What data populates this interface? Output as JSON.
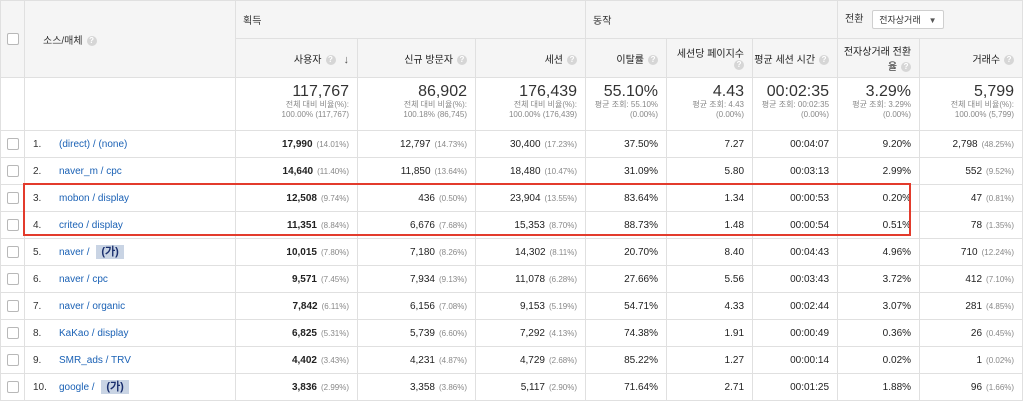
{
  "header_groups": {
    "source_medium": "소스/매체",
    "acquisition": "획득",
    "behavior": "동작",
    "conversion": "전환",
    "conversion_select": "전자상거래"
  },
  "columns": {
    "users": "사용자",
    "new_users": "신규 방문자",
    "sessions": "세션",
    "bounce": "이탈률",
    "pages": "세션당 페이지수",
    "duration": "평균 세션 시간",
    "conv_rate": "전자상거래 전환율",
    "transactions": "거래수"
  },
  "sort_arrow": "↓",
  "totals": {
    "users": {
      "v": "117,767",
      "s1": "전체 대비 비율(%):",
      "s2": "100.00% (117,767)"
    },
    "new_users": {
      "v": "86,902",
      "s1": "전체 대비 비율(%):",
      "s2": "100.18% (86,745)"
    },
    "sessions": {
      "v": "176,439",
      "s1": "전체 대비 비율(%):",
      "s2": "100.00% (176,439)"
    },
    "bounce": {
      "v": "55.10%",
      "s1": "평균 조회: 55.10%",
      "s2": "(0.00%)"
    },
    "pages": {
      "v": "4.43",
      "s1": "평균 조회: 4.43",
      "s2": "(0.00%)"
    },
    "duration": {
      "v": "00:02:35",
      "s1": "평균 조회: 00:02:35",
      "s2": "(0.00%)"
    },
    "conv_rate": {
      "v": "3.29%",
      "s1": "평균 조회: 3.29%",
      "s2": "(0.00%)"
    },
    "transactions": {
      "v": "5,799",
      "s1": "전체 대비 비율(%):",
      "s2": "100.00% (5,799)"
    }
  },
  "rows": [
    {
      "idx": "1.",
      "src": "(direct) / (none)",
      "badge": "",
      "u": "17,990",
      "up": "(14.01%)",
      "nu": "12,797",
      "nup": "(14.73%)",
      "s": "30,400",
      "sp": "(17.23%)",
      "b": "37.50%",
      "p": "7.27",
      "d": "00:04:07",
      "c": "9.20%",
      "t": "2,798",
      "tp": "(48.25%)"
    },
    {
      "idx": "2.",
      "src": "naver_m / cpc",
      "badge": "",
      "u": "14,640",
      "up": "(11.40%)",
      "nu": "11,850",
      "nup": "(13.64%)",
      "s": "18,480",
      "sp": "(10.47%)",
      "b": "31.09%",
      "p": "5.80",
      "d": "00:03:13",
      "c": "2.99%",
      "t": "552",
      "tp": "(9.52%)"
    },
    {
      "idx": "3.",
      "src": "mobon / display",
      "badge": "",
      "u": "12,508",
      "up": "(9.74%)",
      "nu": "436",
      "nup": "(0.50%)",
      "s": "23,904",
      "sp": "(13.55%)",
      "b": "83.64%",
      "p": "1.34",
      "d": "00:00:53",
      "c": "0.20%",
      "t": "47",
      "tp": "(0.81%)"
    },
    {
      "idx": "4.",
      "src": "criteo / display",
      "badge": "",
      "u": "11,351",
      "up": "(8.84%)",
      "nu": "6,676",
      "nup": "(7.68%)",
      "s": "15,353",
      "sp": "(8.70%)",
      "b": "88.73%",
      "p": "1.48",
      "d": "00:00:54",
      "c": "0.51%",
      "t": "78",
      "tp": "(1.35%)"
    },
    {
      "idx": "5.",
      "src": "naver / ",
      "badge": "(가)",
      "u": "10,015",
      "up": "(7.80%)",
      "nu": "7,180",
      "nup": "(8.26%)",
      "s": "14,302",
      "sp": "(8.11%)",
      "b": "20.70%",
      "p": "8.40",
      "d": "00:04:43",
      "c": "4.96%",
      "t": "710",
      "tp": "(12.24%)"
    },
    {
      "idx": "6.",
      "src": "naver / cpc",
      "badge": "",
      "u": "9,571",
      "up": "(7.45%)",
      "nu": "7,934",
      "nup": "(9.13%)",
      "s": "11,078",
      "sp": "(6.28%)",
      "b": "27.66%",
      "p": "5.56",
      "d": "00:03:43",
      "c": "3.72%",
      "t": "412",
      "tp": "(7.10%)"
    },
    {
      "idx": "7.",
      "src": "naver / organic",
      "badge": "",
      "u": "7,842",
      "up": "(6.11%)",
      "nu": "6,156",
      "nup": "(7.08%)",
      "s": "9,153",
      "sp": "(5.19%)",
      "b": "54.71%",
      "p": "4.33",
      "d": "00:02:44",
      "c": "3.07%",
      "t": "281",
      "tp": "(4.85%)"
    },
    {
      "idx": "8.",
      "src": "KaKao / display",
      "badge": "",
      "u": "6,825",
      "up": "(5.31%)",
      "nu": "5,739",
      "nup": "(6.60%)",
      "s": "7,292",
      "sp": "(4.13%)",
      "b": "74.38%",
      "p": "1.91",
      "d": "00:00:49",
      "c": "0.36%",
      "t": "26",
      "tp": "(0.45%)"
    },
    {
      "idx": "9.",
      "src": "SMR_ads / TRV",
      "badge": "",
      "u": "4,402",
      "up": "(3.43%)",
      "nu": "4,231",
      "nup": "(4.87%)",
      "s": "4,729",
      "sp": "(2.68%)",
      "b": "85.22%",
      "p": "1.27",
      "d": "00:00:14",
      "c": "0.02%",
      "t": "1",
      "tp": "(0.02%)"
    },
    {
      "idx": "10.",
      "src": "google / ",
      "badge": "(가)",
      "u": "3,836",
      "up": "(2.99%)",
      "nu": "3,358",
      "nup": "(3.86%)",
      "s": "5,117",
      "sp": "(2.90%)",
      "b": "71.64%",
      "p": "2.71",
      "d": "00:01:25",
      "c": "1.88%",
      "t": "96",
      "tp": "(1.66%)"
    }
  ]
}
